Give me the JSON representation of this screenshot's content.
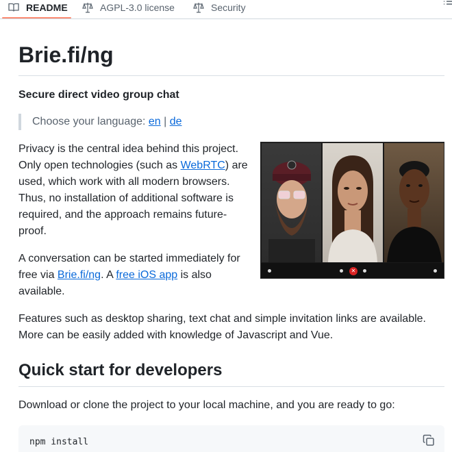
{
  "tabs": [
    {
      "label": "README",
      "icon": "book-icon",
      "active": true
    },
    {
      "label": "AGPL-3.0 license",
      "icon": "scale-icon",
      "active": false
    },
    {
      "label": "Security",
      "icon": "scale-icon",
      "active": false
    }
  ],
  "readme": {
    "title": "Brie.fi/ng",
    "subtitle": "Secure direct video group chat",
    "language": {
      "prefix": "Choose your language: ",
      "en": "en",
      "sep": " | ",
      "de": "de"
    },
    "p1": {
      "before": "Privacy is the central idea behind this project. Only open technologies (such as ",
      "link": "WebRTC",
      "after": ") are used, which work with all modern browsers. Thus, no installation of additional software is required, and the approach remains future-proof."
    },
    "p2": {
      "before": "A conversation can be started immediately for free via ",
      "link1": "Brie.fi/ng",
      "middle": ". A ",
      "link2": "free iOS app",
      "after": " is also available."
    },
    "p3": "Features such as desktop sharing, text chat and simple invitation links are available. More can be easily added with knowledge of Javascript and Vue.",
    "h2": "Quick start for developers",
    "p4": "Download or clone the project to your local machine, and you are ready to go:",
    "code": "npm install"
  },
  "colors": {
    "link": "#0969da",
    "tab_underline": "#fd8c73",
    "hangup": "#d92323"
  }
}
